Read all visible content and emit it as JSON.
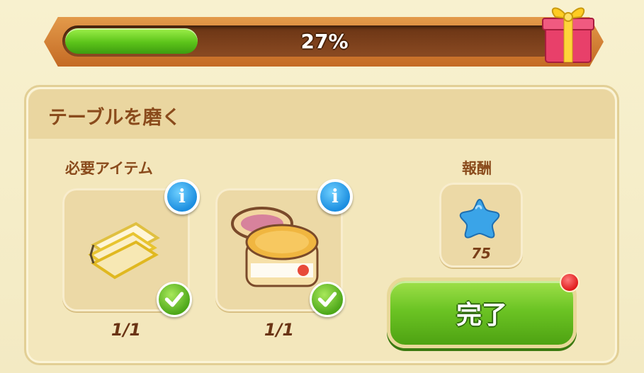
{
  "progress": {
    "percent_label": "27%",
    "value": 0.27
  },
  "task": {
    "title": "テーブルを磨く",
    "required_label": "必要アイテム",
    "reward_label": "報酬",
    "items": [
      {
        "icon": "cloth-icon",
        "count": "1/1",
        "completed": true
      },
      {
        "icon": "polish-jar-icon",
        "count": "1/1",
        "completed": true
      }
    ],
    "reward": {
      "icon": "blue-star-icon",
      "amount": "75"
    },
    "complete_button_label": "完了"
  },
  "colors": {
    "progress_fill": "#5cc41a",
    "title_text": "#8a4b1c",
    "button_green": "#6cc424",
    "info_blue": "#1c8ee0",
    "notification_red": "#e01c1c"
  }
}
